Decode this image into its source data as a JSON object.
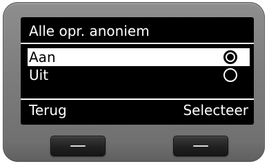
{
  "screen": {
    "title": "Alle opr. anoniem",
    "options": [
      {
        "label": "Aan",
        "selected": true,
        "checked": true
      },
      {
        "label": "Uit",
        "selected": false,
        "checked": false
      }
    ],
    "softkeys": {
      "left_label": "Terug",
      "right_label": "Selecteer"
    }
  },
  "icons": {
    "radio_checked": "radio-checked-icon",
    "radio_unchecked": "radio-unchecked-icon",
    "softkey_marker": "dash-icon"
  },
  "colors": {
    "screen_background": "#000000",
    "screen_text": "#ffffff",
    "highlight_background": "#ffffff",
    "highlight_text": "#000000",
    "device_body": "#7d7d7d",
    "hardware_key": "#202020"
  }
}
